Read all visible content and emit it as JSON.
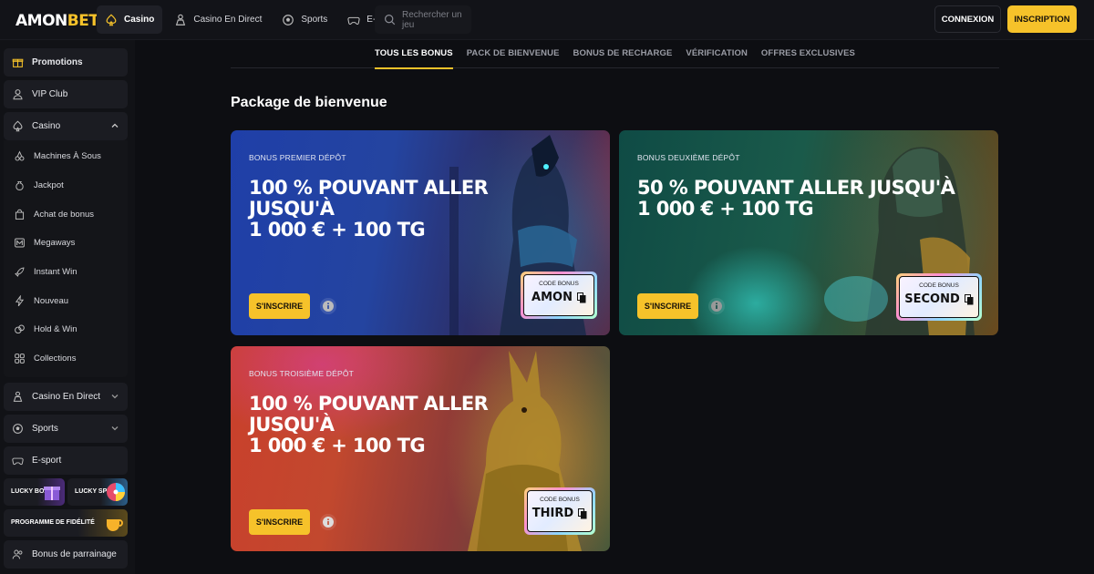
{
  "brand": {
    "logo_prefix": "AMON",
    "logo_suffix": "BET",
    "accent": "#f6c22a"
  },
  "header": {
    "nav": [
      {
        "label": "Casino",
        "icon": "spade-icon",
        "active": true
      },
      {
        "label": "Casino En Direct",
        "icon": "dealer-icon",
        "active": false
      },
      {
        "label": "Sports",
        "icon": "soccer-ball-icon",
        "active": false
      },
      {
        "label": "E-Sport",
        "icon": "gamepad-icon",
        "active": false
      }
    ],
    "search_placeholder": "Rechercher un jeu",
    "login_label": "CONNEXION",
    "signup_label": "INSCRIPTION"
  },
  "sidebar": {
    "top": [
      {
        "label": "Promotions",
        "icon": "gift-icon"
      },
      {
        "label": "VIP Club",
        "icon": "user-icon"
      }
    ],
    "casino": {
      "label": "Casino",
      "icon": "spade-icon",
      "items": [
        {
          "label": "Machines À Sous",
          "icon": "cherries-icon"
        },
        {
          "label": "Jackpot",
          "icon": "money-bag-icon"
        },
        {
          "label": "Achat de bonus",
          "icon": "shopping-bag-icon"
        },
        {
          "label": "Megaways",
          "icon": "megaways-icon"
        },
        {
          "label": "Instant Win",
          "icon": "rocket-icon"
        },
        {
          "label": "Nouveau",
          "icon": "lightning-icon"
        },
        {
          "label": "Hold & Win",
          "icon": "coins-icon"
        },
        {
          "label": "Collections",
          "icon": "grid-icon"
        }
      ]
    },
    "bottom": [
      {
        "label": "Casino En Direct",
        "icon": "dealer-icon"
      },
      {
        "label": "Sports",
        "icon": "soccer-ball-icon"
      },
      {
        "label": "E-sport",
        "icon": "gamepad-icon"
      }
    ],
    "promos": {
      "lucky_box": "LUCKY BOX",
      "lucky_spin": "LUCKY SPIN",
      "loyalty": "PROGRAMME DE FIDÉLITÉ"
    },
    "referral": {
      "label": "Bonus de parrainage",
      "icon": "users-icon"
    }
  },
  "tabs": [
    {
      "label": "TOUS LES BONUS",
      "active": true
    },
    {
      "label": "PACK DE BIENVENUE",
      "active": false
    },
    {
      "label": "BONUS DE RECHARGE",
      "active": false
    },
    {
      "label": "VÉRIFICATION",
      "active": false
    },
    {
      "label": "OFFRES EXCLUSIVES",
      "active": false
    }
  ],
  "section_title": "Package de bienvenue",
  "cards": [
    {
      "label": "BONUS PREMIER DÉPÔT",
      "line1": "100 % POUVANT ALLER JUSQU'À",
      "line2": "1 000 € + 100 TG",
      "button": "S'INSCRIRE",
      "code_label": "CODE BONUS",
      "code": "AMON"
    },
    {
      "label": "BONUS DEUXIÈME DÉPÔT",
      "line1": "50 % POUVANT ALLER JUSQU'À",
      "line2": "1 000 € + 100 TG",
      "button": "S'INSCRIRE",
      "code_label": "CODE BONUS",
      "code": "SECOND"
    },
    {
      "label": "BONUS TROISIÈME DÉPÔT",
      "line1": "100 % POUVANT ALLER JUSQU'À",
      "line2": "1 000 € + 100 TG",
      "button": "S'INSCRIRE",
      "code_label": "CODE BONUS",
      "code": "THIRD"
    }
  ]
}
